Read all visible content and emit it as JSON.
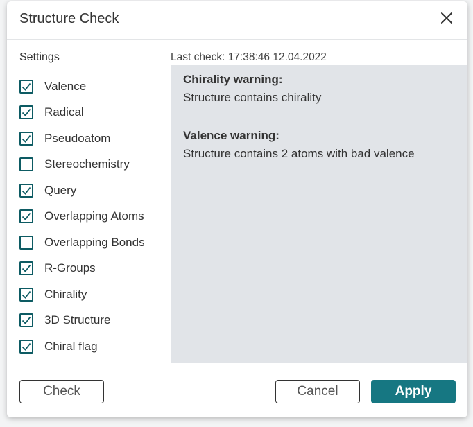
{
  "dialog": {
    "title": "Structure Check"
  },
  "settings": {
    "label": "Settings",
    "items": [
      {
        "label": "Valence",
        "checked": true
      },
      {
        "label": "Radical",
        "checked": true
      },
      {
        "label": "Pseudoatom",
        "checked": true
      },
      {
        "label": "Stereochemistry",
        "checked": false
      },
      {
        "label": "Query",
        "checked": true
      },
      {
        "label": "Overlapping Atoms",
        "checked": true
      },
      {
        "label": "Overlapping Bonds",
        "checked": false
      },
      {
        "label": "R-Groups",
        "checked": true
      },
      {
        "label": "Chirality",
        "checked": true
      },
      {
        "label": "3D Structure",
        "checked": true
      },
      {
        "label": "Chiral flag",
        "checked": true
      }
    ]
  },
  "results": {
    "last_check": "Last check: 17:38:46 12.04.2022",
    "warnings": [
      {
        "title": "Chirality warning:",
        "text": "Structure contains chirality"
      },
      {
        "title": "Valence warning:",
        "text": "Structure contains 2 atoms with bad valence"
      }
    ]
  },
  "footer": {
    "check_label": "Check",
    "cancel_label": "Cancel",
    "apply_label": "Apply"
  },
  "colors": {
    "accent": "#167782",
    "checkbox": "#0d5b63",
    "results_bg": "#e1e4e8"
  }
}
